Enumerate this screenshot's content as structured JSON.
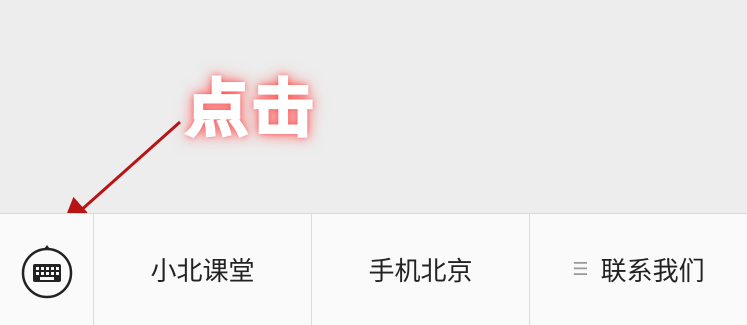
{
  "annotation": {
    "text": "点击",
    "color": "#e0141a"
  },
  "menu_bar": {
    "keyboard_icon": "keyboard-icon",
    "items": [
      {
        "label": "小北课堂"
      },
      {
        "label": "手机北京"
      },
      {
        "label": "联系我们",
        "icon": "submenu-list-icon"
      }
    ]
  },
  "colors": {
    "background": "#ededed",
    "menu_background": "#fafafa",
    "arrow": "#b81414"
  }
}
